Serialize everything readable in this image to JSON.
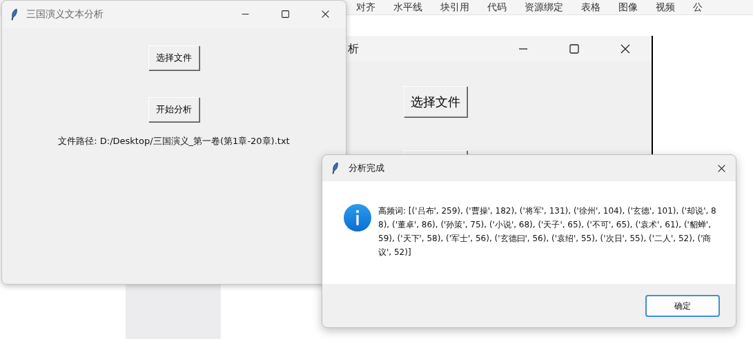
{
  "editor_toolbar": {
    "items": [
      "对齐",
      "水平线",
      "块引用",
      "代码",
      "资源绑定",
      "表格",
      "图像",
      "视频",
      "公"
    ]
  },
  "back_window": {
    "title": "析",
    "buttons": [
      "选择文件"
    ]
  },
  "main_window": {
    "title": "三国演义文本分析",
    "buttons": [
      "选择文件",
      "开始分析"
    ],
    "file_path": "文件路径: D:/Desktop/三国演义_第一卷(第1章-20章).txt"
  },
  "dialog": {
    "title": "分析完成",
    "message": "高频词: [('吕布', 259), ('曹操', 182), ('将军', 131), ('徐州', 104), ('玄德', 101), ('却说', 88), ('董卓', 86), ('孙策', 75), ('小说', 68), ('天子', 65), ('不可', 65), ('袁术', 61), ('貂蝉', 59), ('天下', 58), ('军士', 56), ('玄德曰', 56), ('袁绍', 55), ('次日', 55), ('二人', 52), ('商议', 52)]",
    "ok_button": "确定"
  }
}
